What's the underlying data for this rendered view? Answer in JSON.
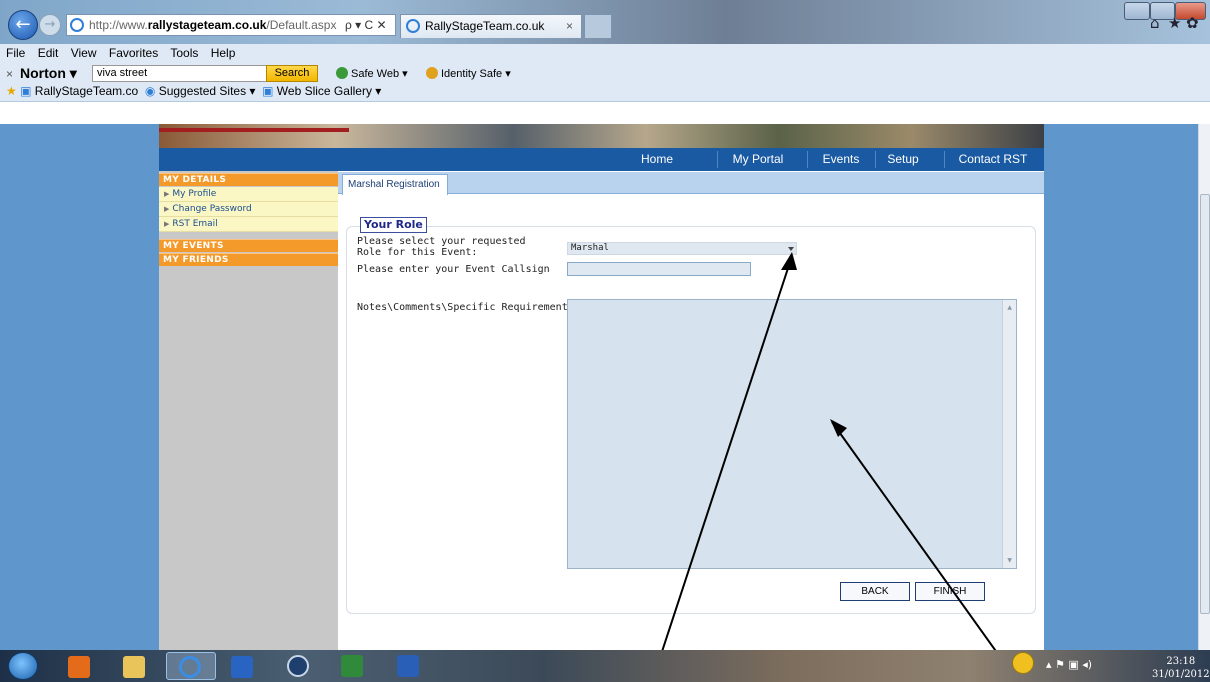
{
  "browser": {
    "address_prefix": "http://www.",
    "address_domain": "rallystageteam.co.uk",
    "address_path": "/Default.aspx",
    "address_controls": "ρ ▾ C ✕",
    "tab_title": "RallyStageTeam.co.uk",
    "tab_close": "×",
    "back_glyph": "←",
    "forward_glyph": "→",
    "home_icon": "⌂",
    "star_icon": "★",
    "gear_icon": "✿"
  },
  "menu": [
    "File",
    "Edit",
    "View",
    "Favorites",
    "Tools",
    "Help"
  ],
  "norton": {
    "close": "×",
    "logo": "Norton ▾",
    "search_value": "viva street",
    "search_button": "Search",
    "safe_web": "Safe Web ▾",
    "identity_safe": "Identity Safe ▾"
  },
  "favorites": {
    "site": "RallyStageTeam.co",
    "suggested": "Suggested Sites ▾",
    "slice": "Web Slice Gallery ▾"
  },
  "site_nav": {
    "items": [
      "Home",
      "My Portal",
      "Events",
      "Setup",
      "Contact RST"
    ]
  },
  "sidebar": {
    "my_details": "My Details",
    "my_details_links": [
      "My Profile",
      "Change Password",
      "RST Email"
    ],
    "my_events": "My Events",
    "my_friends": "My Friends",
    "arrow": "▶"
  },
  "form": {
    "tab": "Marshal Registration",
    "legend": "Your Role",
    "role_label_line1": "Please select your requested",
    "role_label_line2": "Role for this Event:",
    "role_value": "Marshal",
    "callsign_label": "Please enter your Event Callsign",
    "callsign_value": "",
    "notes_label": "Notes\\Comments\\Specific Requirements:",
    "notes_value": "",
    "back_button": "BACK",
    "finish_button": "FINISH"
  },
  "taskbar": {
    "time": "23:18",
    "date": "31/01/2012"
  },
  "colors": {
    "page_bg": "#5f97cc",
    "nav_bg": "#1a5aa3",
    "sidebar_header": "#f39a2a",
    "sidebar_sub": "#fbf7c5",
    "input_bg": "#dfe8f1"
  }
}
